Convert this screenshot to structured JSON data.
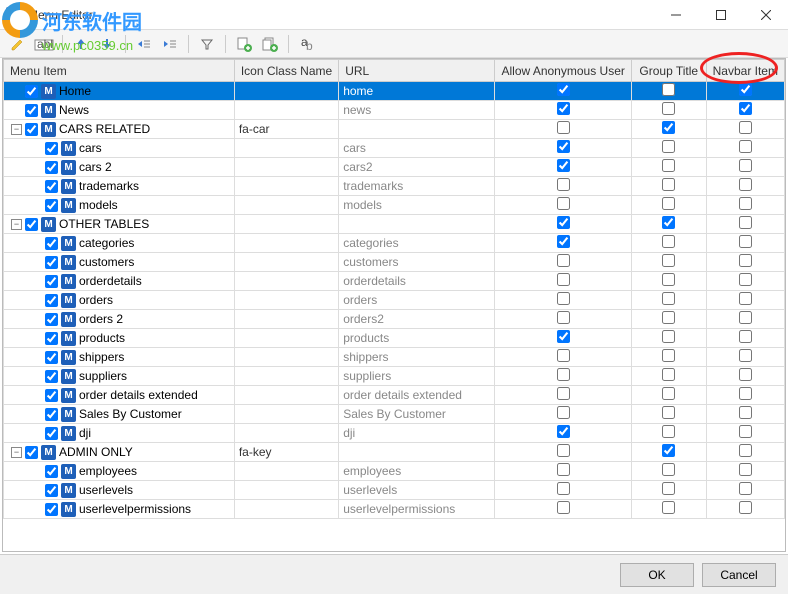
{
  "window": {
    "title": "Menu Editor",
    "app_icon_letter": "A"
  },
  "watermark": {
    "text": "河东软件园",
    "url": "www.pc0359.cn"
  },
  "toolbar": {
    "icons": [
      "pencil",
      "abl",
      "up",
      "down",
      "outdent",
      "indent",
      "filter",
      "add-page",
      "add-pages",
      "text-tool"
    ]
  },
  "columns": {
    "menu_item": "Menu Item",
    "icon_class": "Icon Class Name",
    "url": "URL",
    "anon": "Allow Anonymous User",
    "group_title": "Group Title",
    "navbar": "Navbar Item"
  },
  "rows": [
    {
      "depth": 0,
      "expander": "",
      "checked": true,
      "label": "Home",
      "icon_class": "",
      "url": "home",
      "anon": true,
      "group": false,
      "navbar": true,
      "selected": true
    },
    {
      "depth": 0,
      "expander": "",
      "checked": true,
      "label": "News",
      "icon_class": "",
      "url": "news",
      "anon": true,
      "group": false,
      "navbar": true
    },
    {
      "depth": 0,
      "expander": "-",
      "checked": true,
      "label": "CARS RELATED",
      "icon_class": "fa-car",
      "url": "",
      "anon": false,
      "group": true,
      "navbar": false
    },
    {
      "depth": 1,
      "expander": "",
      "checked": true,
      "label": "cars",
      "icon_class": "",
      "url": "cars",
      "anon": true,
      "group": false,
      "navbar": false
    },
    {
      "depth": 1,
      "expander": "",
      "checked": true,
      "label": "cars 2",
      "icon_class": "",
      "url": "cars2",
      "anon": true,
      "group": false,
      "navbar": false
    },
    {
      "depth": 1,
      "expander": "",
      "checked": true,
      "label": "trademarks",
      "icon_class": "",
      "url": "trademarks",
      "anon": false,
      "group": false,
      "navbar": false
    },
    {
      "depth": 1,
      "expander": "",
      "checked": true,
      "label": "models",
      "icon_class": "",
      "url": "models",
      "anon": false,
      "group": false,
      "navbar": false
    },
    {
      "depth": 0,
      "expander": "-",
      "checked": true,
      "label": "OTHER TABLES",
      "icon_class": "",
      "url": "",
      "anon": true,
      "group": true,
      "navbar": false
    },
    {
      "depth": 1,
      "expander": "",
      "checked": true,
      "label": "categories",
      "icon_class": "",
      "url": "categories",
      "anon": true,
      "group": false,
      "navbar": false
    },
    {
      "depth": 1,
      "expander": "",
      "checked": true,
      "label": "customers",
      "icon_class": "",
      "url": "customers",
      "anon": false,
      "group": false,
      "navbar": false
    },
    {
      "depth": 1,
      "expander": "",
      "checked": true,
      "label": "orderdetails",
      "icon_class": "",
      "url": "orderdetails",
      "anon": false,
      "group": false,
      "navbar": false
    },
    {
      "depth": 1,
      "expander": "",
      "checked": true,
      "label": "orders",
      "icon_class": "",
      "url": "orders",
      "anon": false,
      "group": false,
      "navbar": false
    },
    {
      "depth": 1,
      "expander": "",
      "checked": true,
      "label": "orders 2",
      "icon_class": "",
      "url": "orders2",
      "anon": false,
      "group": false,
      "navbar": false
    },
    {
      "depth": 1,
      "expander": "",
      "checked": true,
      "label": "products",
      "icon_class": "",
      "url": "products",
      "anon": true,
      "group": false,
      "navbar": false
    },
    {
      "depth": 1,
      "expander": "",
      "checked": true,
      "label": "shippers",
      "icon_class": "",
      "url": "shippers",
      "anon": false,
      "group": false,
      "navbar": false
    },
    {
      "depth": 1,
      "expander": "",
      "checked": true,
      "label": "suppliers",
      "icon_class": "",
      "url": "suppliers",
      "anon": false,
      "group": false,
      "navbar": false
    },
    {
      "depth": 1,
      "expander": "",
      "checked": true,
      "label": "order details extended",
      "icon_class": "",
      "url": "order details extended",
      "anon": false,
      "group": false,
      "navbar": false
    },
    {
      "depth": 1,
      "expander": "",
      "checked": true,
      "label": "Sales By Customer",
      "icon_class": "",
      "url": "Sales By Customer",
      "anon": false,
      "group": false,
      "navbar": false
    },
    {
      "depth": 1,
      "expander": "",
      "checked": true,
      "label": "dji",
      "icon_class": "",
      "url": "dji",
      "anon": true,
      "group": false,
      "navbar": false
    },
    {
      "depth": 0,
      "expander": "-",
      "checked": true,
      "label": "ADMIN ONLY",
      "icon_class": "fa-key",
      "url": "",
      "anon": false,
      "group": true,
      "navbar": false
    },
    {
      "depth": 1,
      "expander": "",
      "checked": true,
      "label": "employees",
      "icon_class": "",
      "url": "employees",
      "anon": false,
      "group": false,
      "navbar": false
    },
    {
      "depth": 1,
      "expander": "",
      "checked": true,
      "label": "userlevels",
      "icon_class": "",
      "url": "userlevels",
      "anon": false,
      "group": false,
      "navbar": false
    },
    {
      "depth": 1,
      "expander": "",
      "checked": true,
      "label": "userlevelpermissions",
      "icon_class": "",
      "url": "userlevelpermissions",
      "anon": false,
      "group": false,
      "navbar": false
    }
  ],
  "footer": {
    "ok": "OK",
    "cancel": "Cancel"
  }
}
